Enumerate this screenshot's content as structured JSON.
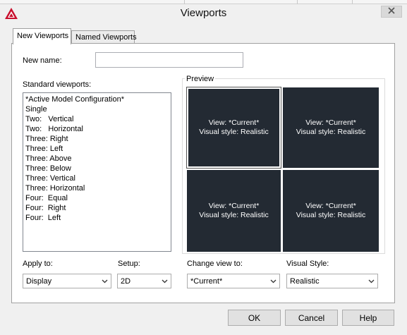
{
  "window": {
    "title": "Viewports"
  },
  "tabs": [
    {
      "label": "New Viewports"
    },
    {
      "label": "Named Viewports"
    }
  ],
  "form": {
    "new_name_label": "New name:",
    "new_name_value": "",
    "standard_viewports_label": "Standard viewports:",
    "standard_viewports": [
      "*Active Model Configuration*",
      "Single",
      "Two:   Vertical",
      "Two:   Horizontal",
      "Three: Right",
      "Three: Left",
      "Three: Above",
      "Three: Below",
      "Three: Vertical",
      "Three: Horizontal",
      "Four:  Equal",
      "Four:  Right",
      "Four:  Left"
    ],
    "apply_to_label": "Apply to:",
    "apply_to_value": "Display",
    "setup_label": "Setup:",
    "setup_value": "2D"
  },
  "preview": {
    "label": "Preview",
    "viewports": [
      {
        "view": "View: *Current*",
        "style": "Visual style: Realistic"
      },
      {
        "view": "View: *Current*",
        "style": "Visual style: Realistic"
      },
      {
        "view": "View: *Current*",
        "style": "Visual style: Realistic"
      },
      {
        "view": "View: *Current*",
        "style": "Visual style: Realistic"
      }
    ],
    "change_view_label": "Change view to:",
    "change_view_value": "*Current*",
    "visual_style_label": "Visual Style:",
    "visual_style_value": "Realistic"
  },
  "buttons": {
    "ok": "OK",
    "cancel": "Cancel",
    "help": "Help"
  },
  "colors": {
    "viewport_bg": "#232a33",
    "app_icon_red": "#c8102e"
  },
  "icons": {
    "app": "autocad-logo-icon",
    "close": "close-icon",
    "dropdown": "chevron-down-icon"
  }
}
